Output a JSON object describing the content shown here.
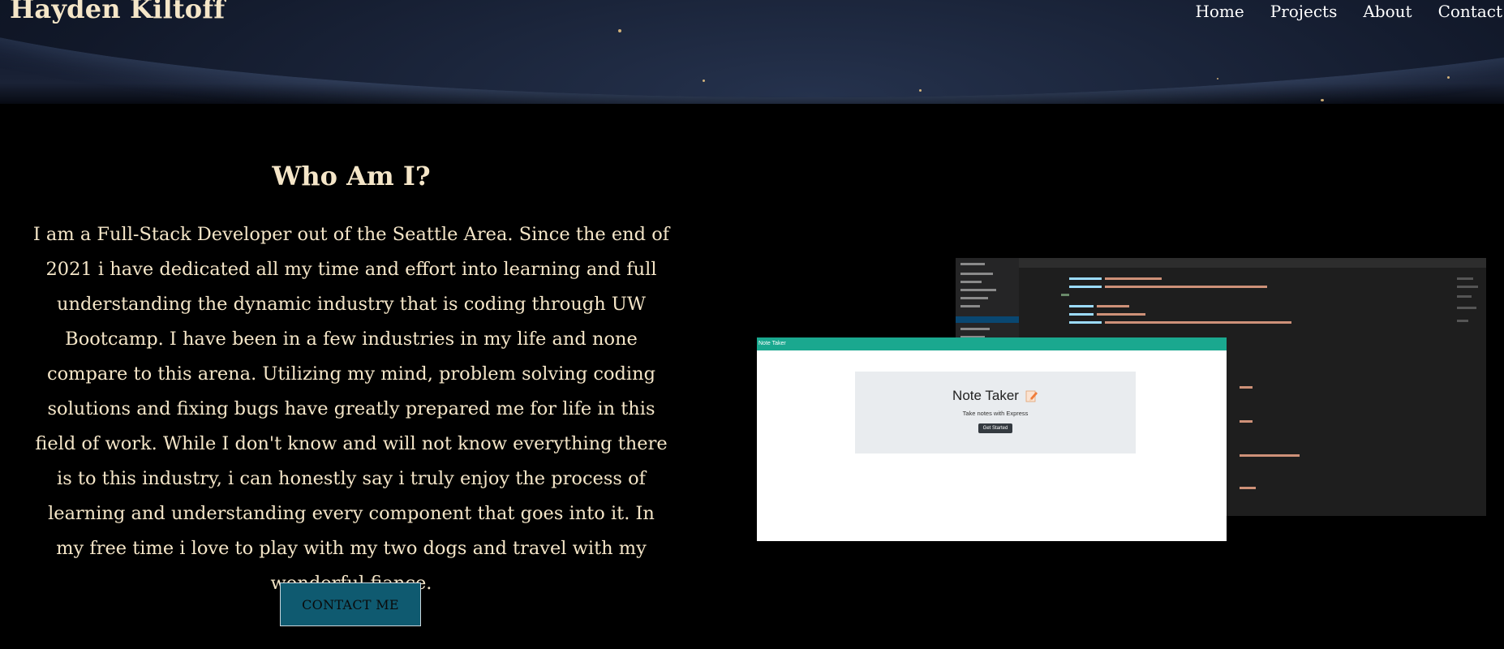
{
  "header": {
    "brand": "Hayden Kiltoff",
    "nav": [
      "Home",
      "Projects",
      "About",
      "Contact"
    ]
  },
  "about": {
    "title": "Who Am I?",
    "bio": "I am a Full-Stack Developer out of the Seattle Area. Since the end of 2021 i have dedicated all my time and effort into learning and full understanding the dynamic industry that is coding through UW Bootcamp. I have been in a few industries in my life and none compare to this arena. Utilizing my mind, problem solving coding solutions and fixing bugs have greatly prepared me for life in this field of work. While I don't know and will not know everything there is to this industry, i can honestly say i truly enjoy the process of learning and understanding every component that goes into it. In my free time i love to play with my two dogs and travel with my wonderful fiance.",
    "contact_button": "CONTACT ME"
  },
  "project_preview": {
    "app_bar": "Note Taker",
    "title": "Note Taker",
    "subtitle": "Take notes with Express",
    "button": "Get Started",
    "icon": "pencil-icon"
  },
  "colors": {
    "background": "#000000",
    "text": "#f5e6c8",
    "button": "#0f5a70",
    "app_bar": "#1aa88f"
  }
}
